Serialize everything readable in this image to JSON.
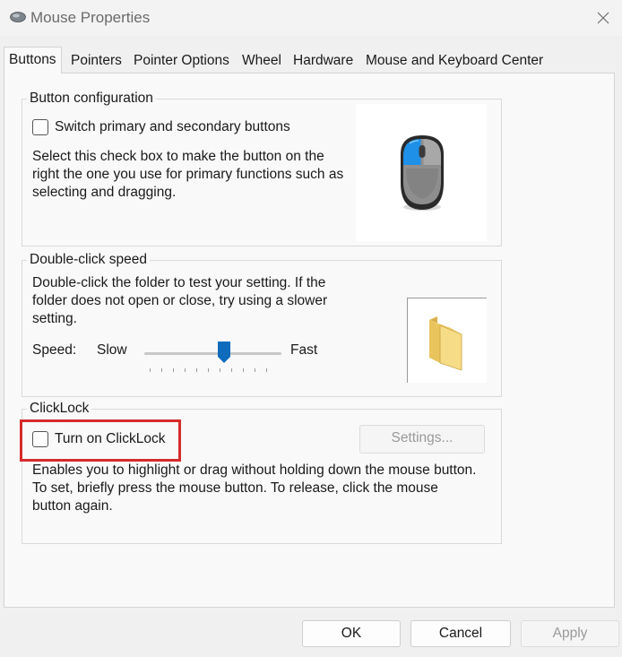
{
  "window": {
    "title": "Mouse Properties"
  },
  "tabs": [
    {
      "label": "Buttons",
      "active": true
    },
    {
      "label": "Pointers"
    },
    {
      "label": "Pointer Options"
    },
    {
      "label": "Wheel"
    },
    {
      "label": "Hardware"
    },
    {
      "label": "Mouse and Keyboard Center"
    }
  ],
  "button_config": {
    "legend": "Button configuration",
    "checkbox_label": "Switch primary and secondary buttons",
    "checked": false,
    "description": "Select this check box to make the button on the right the one you use for primary functions such as selecting and dragging."
  },
  "double_click": {
    "legend": "Double-click speed",
    "description": "Double-click the folder to test your setting. If the folder does not open or close, try using a slower setting.",
    "speed_label": "Speed:",
    "slow_label": "Slow",
    "fast_label": "Fast",
    "speed_value": 0.6
  },
  "clicklock": {
    "legend": "ClickLock",
    "checkbox_label": "Turn on ClickLock",
    "checked": false,
    "settings_label": "Settings...",
    "description": "Enables you to highlight or drag without holding down the mouse button. To set, briefly press the mouse button. To release, click the mouse button again."
  },
  "footer": {
    "ok_label": "OK",
    "cancel_label": "Cancel",
    "apply_label": "Apply"
  },
  "icons": {
    "app": "mouse-icon",
    "close": "close-icon",
    "mouse_preview": "mouse-preview-icon",
    "folder": "folder-icon"
  },
  "colors": {
    "accent": "#0f6cbd",
    "highlight": "#d62b2b",
    "mouse_primary_button": "#1e90e8"
  }
}
